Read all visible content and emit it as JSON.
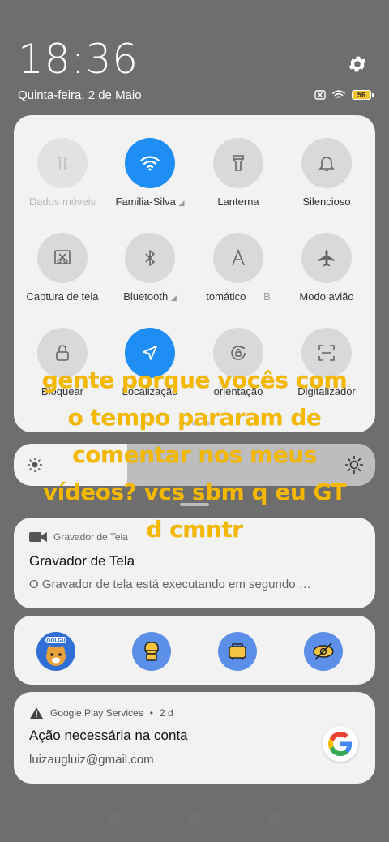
{
  "status": {
    "time": "18:36",
    "date": "Quinta-feira, 2 de Maio",
    "battery": "56"
  },
  "quick_settings": {
    "tiles": [
      {
        "label": "Dados móveis",
        "icon": "mobile-data-icon",
        "state": "disabled"
      },
      {
        "label": "Familia-Silva",
        "icon": "wifi-icon",
        "state": "active"
      },
      {
        "label": "Lanterna",
        "icon": "flashlight-icon",
        "state": "off"
      },
      {
        "label": "Silencioso",
        "icon": "bell-icon",
        "state": "off"
      },
      {
        "label": "Captura de tela",
        "icon": "screenshot-icon",
        "state": "off"
      },
      {
        "label": "Bluetooth",
        "icon": "bluetooth-icon",
        "state": "off"
      },
      {
        "label": "tomático",
        "icon": "auto-brightness-icon",
        "state": "off"
      },
      {
        "label": "B",
        "icon": "",
        "state": "off"
      },
      {
        "label": "Modo avião",
        "icon": "airplane-icon",
        "state": "off"
      },
      {
        "label": "Bloquear",
        "icon": "lock-icon",
        "state": "off"
      },
      {
        "label": "Localização",
        "icon": "location-icon",
        "state": "active"
      },
      {
        "label": "orientação",
        "icon": "rotation-lock-icon",
        "state": "off"
      },
      {
        "label": "Digitalizador",
        "icon": "scanner-icon",
        "state": "off"
      }
    ],
    "page_dots": 3,
    "active_page": 1
  },
  "brightness": {
    "level": 0.3
  },
  "notifications": [
    {
      "app": "Gravador de Tela",
      "title": "Gravador de Tela",
      "body": "O Gravador de tela está executando em segundo …"
    },
    {
      "app": "Google Play Services",
      "time": "2 d",
      "title": "Ação necessária na conta",
      "body": "luizaugluiz@gmail.com"
    }
  ],
  "app_row": [
    {
      "icon": "coolguy-avatar-icon",
      "label": "COOLGUY"
    },
    {
      "icon": "app-bubble-icon-1"
    },
    {
      "icon": "app-bubble-icon-2"
    },
    {
      "icon": "eye-off-icon"
    }
  ],
  "overlay_caption": "gente porque vocês com o tempo pararam de comentar nos meus vídeos? vcs sbm q eu GT d cmntr",
  "colors": {
    "accent": "#1e8ef5",
    "caption": "#f5b800"
  }
}
